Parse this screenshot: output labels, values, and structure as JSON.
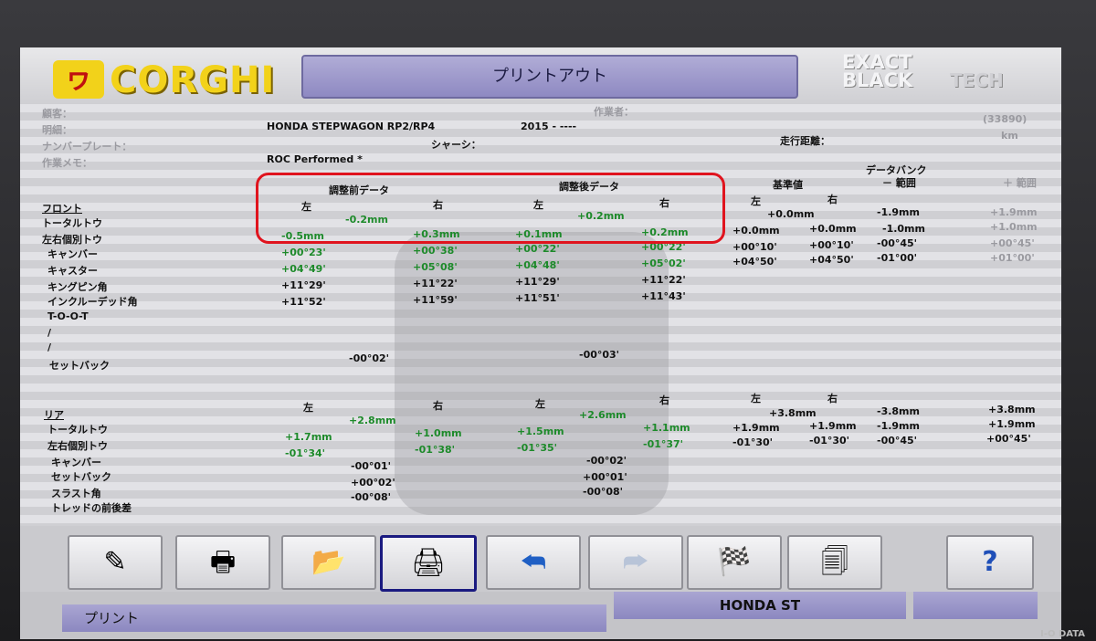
{
  "header": {
    "logo_mark": "ヮ",
    "logo_text": "CORGHI",
    "title": "プリントアウト",
    "brand_line1": "EXACT",
    "brand_line2": "BLACK",
    "brand_line3": "TECH"
  },
  "meta": {
    "client_label": "顧客：",
    "operator_label": "作業者：",
    "spec_label": "明細：",
    "vehicle": "HONDA STEPWAGON RP2/RP4",
    "year": "2015 - ----",
    "plate_label": "ナンバープレート：",
    "chassis_label": "シャーシ：",
    "mileage_label": "走行距離：",
    "mileage_value": "(33890)",
    "mileage_unit": "km",
    "memo_label": "作業メモ：",
    "memo_value": "ROC Performed *"
  },
  "headings": {
    "before": "調整前データ",
    "after": "調整後データ",
    "databank": "データバンク",
    "standard": "基準値",
    "minus_range": "－ 範囲",
    "plus_range": "＋ 範囲",
    "left": "左",
    "right": "右"
  },
  "front": {
    "section": "フロント",
    "labels": [
      "トータルトウ",
      "左右個別トウ",
      "キャンバー",
      "キャスター",
      "キングピン角",
      "インクルーデッド角",
      "T-O-O-T",
      "/",
      "/",
      "セットバック"
    ],
    "total_toe_before": "-0.2mm",
    "total_toe_after": "+0.2mm",
    "setback_before": "-00°02'",
    "setback_after": "-00°03'",
    "rows": [
      {
        "bl": "-0.5mm",
        "br": "+0.3mm",
        "al": "+0.1mm",
        "ar": "+0.2mm"
      },
      {
        "bl": "+00°23'",
        "br": "+00°38'",
        "al": "+00°22'",
        "ar": "+00°22'"
      },
      {
        "bl": "+04°49'",
        "br": "+05°08'",
        "al": "+04°48'",
        "ar": "+05°02'"
      },
      {
        "bl": "+11°29'",
        "br": "+11°22'",
        "al": "+11°29'",
        "ar": "+11°22'"
      },
      {
        "bl": "+11°52'",
        "br": "+11°59'",
        "al": "+11°51'",
        "ar": "+11°43'"
      }
    ],
    "std_total": "+0.0mm",
    "std_total_minus": "-1.9mm",
    "std_total_plus": "+1.9mm",
    "std_rows": [
      {
        "l": "+0.0mm",
        "r": "+0.0mm",
        "m": "-1.0mm",
        "p": "+1.0mm"
      },
      {
        "l": "+00°10'",
        "r": "+00°10'",
        "m": "-00°45'",
        "p": "+00°45'"
      },
      {
        "l": "+04°50'",
        "r": "+04°50'",
        "m": "-01°00'",
        "p": "+01°00'"
      }
    ]
  },
  "rear": {
    "section": "リア",
    "labels": [
      "トータルトウ",
      "左右個別トウ",
      "キャンバー",
      "セットバック",
      "スラスト角",
      "トレッドの前後差"
    ],
    "total_toe_before": "+2.8mm",
    "total_toe_after": "+2.6mm",
    "rows": [
      {
        "bl": "+1.7mm",
        "br": "+1.0mm",
        "al": "+1.5mm",
        "ar": "+1.1mm"
      },
      {
        "bl": "-01°34'",
        "br": "-01°38'",
        "al": "-01°35'",
        "ar": "-01°37'"
      }
    ],
    "setback_before": "-00°01'",
    "setback_after": "-00°02'",
    "thrust_before": "+00°02'",
    "thrust_after": "+00°01'",
    "tread_before": "-00°08'",
    "tread_after": "-00°08'",
    "std_total": "+3.8mm",
    "std_total_minus": "-3.8mm",
    "std_total_plus": "+3.8mm",
    "std_rows": [
      {
        "l": "+1.9mm",
        "r": "+1.9mm",
        "m": "-1.9mm",
        "p": "+1.9mm"
      },
      {
        "l": "-01°30'",
        "r": "-01°30'",
        "m": "-00°45'",
        "p": "+00°45'"
      }
    ]
  },
  "toolbar": {
    "icons": [
      "edit-document-icon",
      "print-vehicle-icon",
      "open-folder-vehicle-icon",
      "printer-icon",
      "back-arrow-icon",
      "forward-arrow-icon",
      "checkered-flag-icon",
      "print-preview-icon",
      "help-icon"
    ],
    "help_glyph": "?"
  },
  "status": {
    "left": "プリント",
    "center": "HONDA ST"
  },
  "monitor_brand": "I-O DATA"
}
